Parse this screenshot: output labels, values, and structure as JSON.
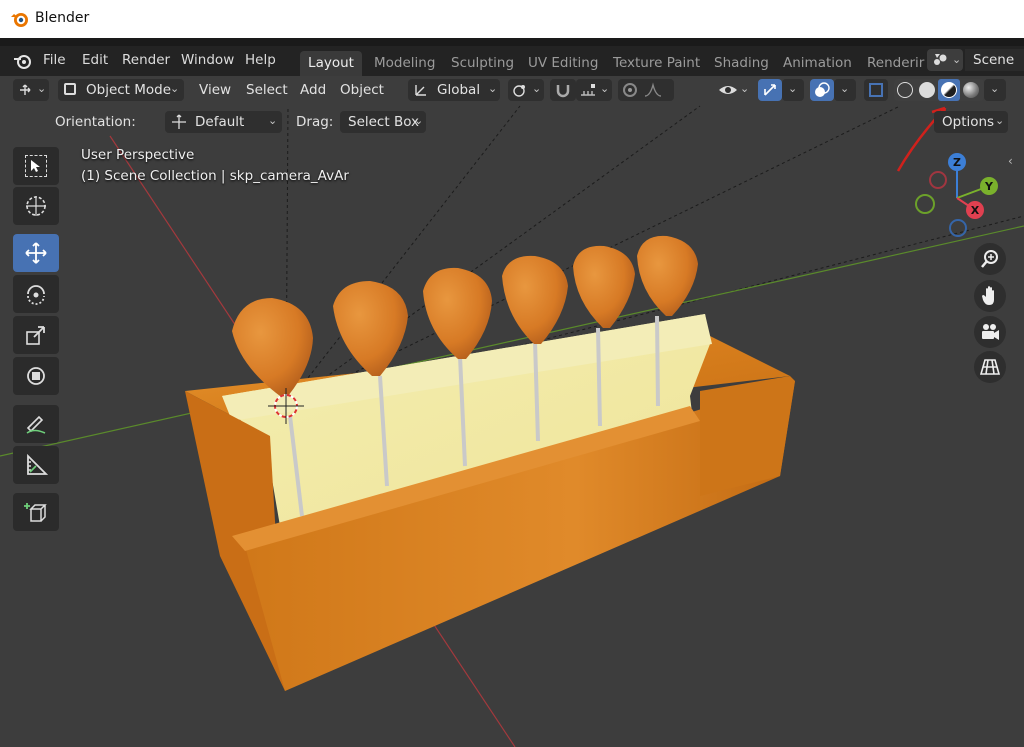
{
  "window": {
    "title": "Blender"
  },
  "menu": {
    "file": "File",
    "edit": "Edit",
    "render": "Render",
    "window": "Window",
    "help": "Help"
  },
  "workspaces": {
    "layout": "Layout",
    "modeling": "Modeling",
    "sculpting": "Sculpting",
    "uv_editing": "UV Editing",
    "texture_paint": "Texture Paint",
    "shading": "Shading",
    "animation": "Animation",
    "rendering": "Renderir"
  },
  "scene": {
    "name": "Scene"
  },
  "header": {
    "mode": "Object Mode",
    "view": "View",
    "select": "Select",
    "add": "Add",
    "object": "Object",
    "transform_orientation": "Global"
  },
  "tool_settings": {
    "orientation_label": "Orientation:",
    "orientation_value": "Default",
    "drag_label": "Drag:",
    "drag_value": "Select Box",
    "options": "Options"
  },
  "viewport_info": {
    "perspective": "User Perspective",
    "collection": "(1) Scene Collection | skp_camera_AvAr"
  },
  "gizmo": {
    "x": "X",
    "y": "Y",
    "z": "Z"
  },
  "colors": {
    "accent": "#4772b3",
    "viewport_bg": "#3d3d3d",
    "annotation": "#d0211c"
  },
  "shading": {
    "active_mode": "material-preview"
  }
}
